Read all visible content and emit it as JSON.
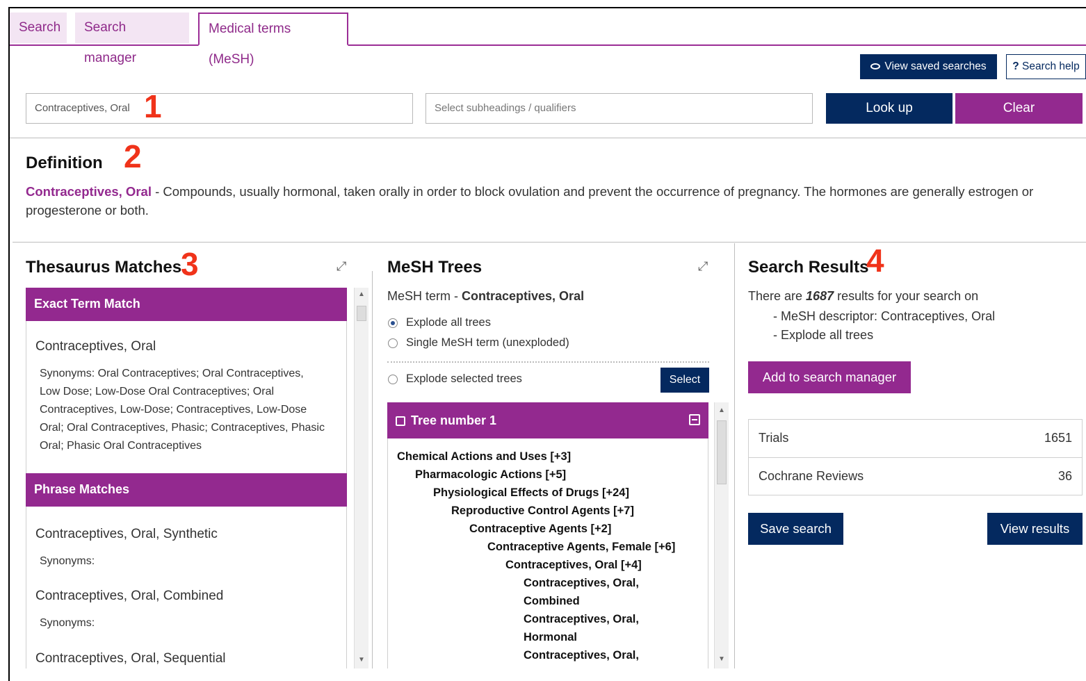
{
  "tabs": [
    {
      "label": "Search"
    },
    {
      "label": "Search manager"
    },
    {
      "label": "Medical terms (MeSH)"
    }
  ],
  "toolbar": {
    "view_saved_label": "View saved searches",
    "search_help_label": "Search help",
    "search_help_icon": "?"
  },
  "search": {
    "term_value": "Contraceptives, Oral",
    "qualifier_placeholder": "Select subheadings / qualifiers",
    "lookup_label": "Look up",
    "clear_label": "Clear"
  },
  "callouts": [
    "1",
    "2",
    "3",
    "4"
  ],
  "definition": {
    "heading": "Definition",
    "term": "Contraceptives, Oral",
    "text": " - Compounds, usually hormonal, taken orally in order to block ovulation and prevent the occurrence of pregnancy. The hormones are generally estrogen or progesterone or both."
  },
  "thesaurus": {
    "heading": "Thesaurus Matches",
    "exact_header": "Exact Term Match",
    "exact_term": "Contraceptives, Oral",
    "exact_synonyms": [
      "Synonyms: Oral Contraceptives; Oral Contraceptives,",
      "Low Dose; Low-Dose Oral Contraceptives; Oral",
      "Contraceptives, Low-Dose; Contraceptives, Low-Dose",
      "Oral; Oral Contraceptives, Phasic; Contraceptives, Phasic",
      "Oral; Phasic Oral Contraceptives"
    ],
    "phrase_header": "Phrase Matches",
    "phrase_items": [
      {
        "term": "Contraceptives, Oral, Synthetic",
        "synonyms": "Synonyms:"
      },
      {
        "term": "Contraceptives, Oral, Combined",
        "synonyms": "Synonyms:"
      },
      {
        "term": "Contraceptives, Oral, Sequential"
      }
    ]
  },
  "mesh_trees": {
    "heading": "MeSH Trees",
    "term_prefix": "MeSH term - ",
    "term": "Contraceptives, Oral",
    "options": [
      "Explode all trees",
      "Single MeSH term (unexploded)",
      "Explode selected trees"
    ],
    "select_label": "Select",
    "tree_header": "Tree number 1",
    "tree_items": [
      "Chemical Actions and Uses [+3]",
      "Pharmacologic Actions [+5]",
      "Physiological Effects of Drugs [+24]",
      "Reproductive Control Agents [+7]",
      "Contraceptive Agents [+2]",
      "Contraceptive Agents, Female [+6]",
      "Contraceptives, Oral [+4]",
      "Contraceptives, Oral,",
      "Combined",
      "Contraceptives, Oral,",
      "Hormonal",
      "Contraceptives, Oral,"
    ]
  },
  "results": {
    "heading": "Search Results",
    "intro_pre": "There are ",
    "count": "1687",
    "intro_post": " results for your search on",
    "line1": "- MeSH descriptor: Contraceptives, Oral",
    "line2": "- Explode all trees",
    "add_label": "Add to search manager",
    "rows": [
      {
        "label": "Trials",
        "value": "1651"
      },
      {
        "label": "Cochrane Reviews",
        "value": "36"
      }
    ],
    "save_label": "Save search",
    "view_label": "View results"
  },
  "colors": {
    "purple": "#93298f",
    "navy": "#04295f",
    "callout": "#f0331a"
  }
}
